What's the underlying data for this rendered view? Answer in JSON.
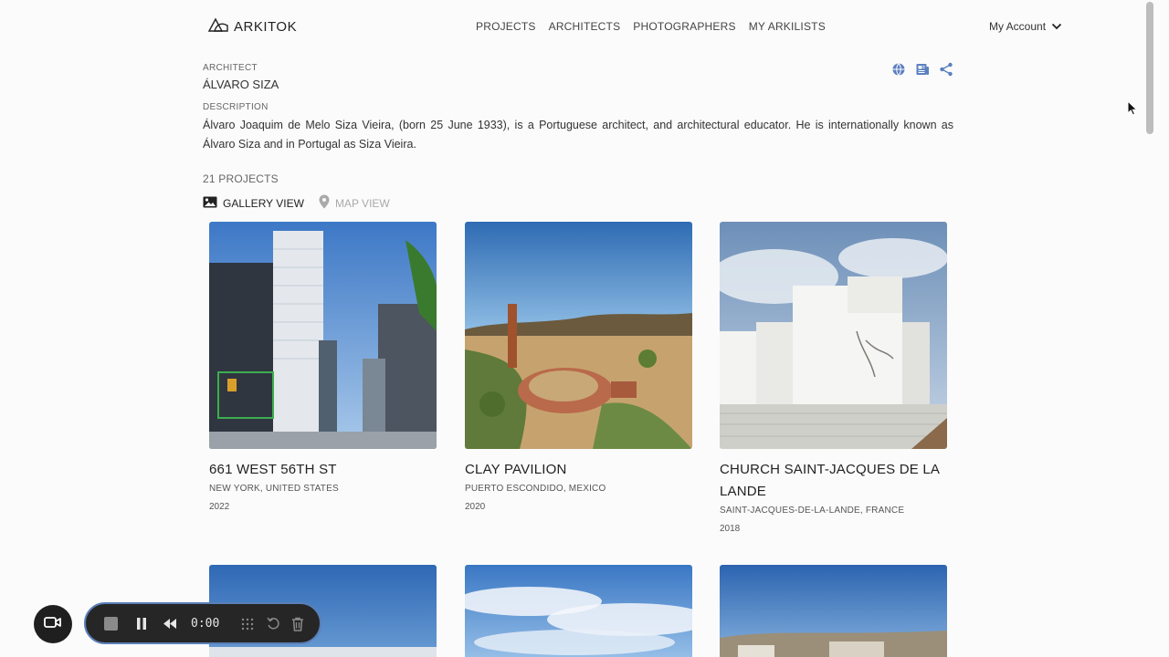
{
  "brand": {
    "name": "ARKITOK"
  },
  "nav": {
    "items": [
      "PROJECTS",
      "ARCHITECTS",
      "PHOTOGRAPHERS",
      "MY ARKILISTS"
    ]
  },
  "account": {
    "label": "My Account"
  },
  "architect": {
    "label": "ARCHITECT",
    "name": "ÁLVARO SIZA",
    "description_label": "DESCRIPTION",
    "description": "Álvaro Joaquim de Melo Siza Vieira, (born 25 June 1933), is a Portuguese architect, and architectural educator. He is internationally known as Álvaro Siza and in Portugal as Siza Vieira."
  },
  "tools": {
    "icons": [
      "globe-icon",
      "news-icon",
      "share-icon"
    ]
  },
  "projects": {
    "count": "21 PROJECTS",
    "gallery_view": "GALLERY VIEW",
    "map_view": "MAP VIEW",
    "cards": [
      {
        "title": "661 WEST 56TH ST",
        "location": "NEW YORK, UNITED STATES",
        "year": "2022"
      },
      {
        "title": "CLAY PAVILION",
        "location": "PUERTO ESCONDIDO, MEXICO",
        "year": "2020"
      },
      {
        "title": "CHURCH SAINT-JACQUES DE LA LANDE",
        "location": "SAINT-JACQUES-DE-LA-LANDE, FRANCE",
        "year": "2018"
      }
    ]
  },
  "recorder": {
    "time": "0:00"
  },
  "colors": {
    "accent": "#5b7fc0",
    "recorder_bg": "#262626",
    "recorder_border": "#5a7fb8"
  }
}
